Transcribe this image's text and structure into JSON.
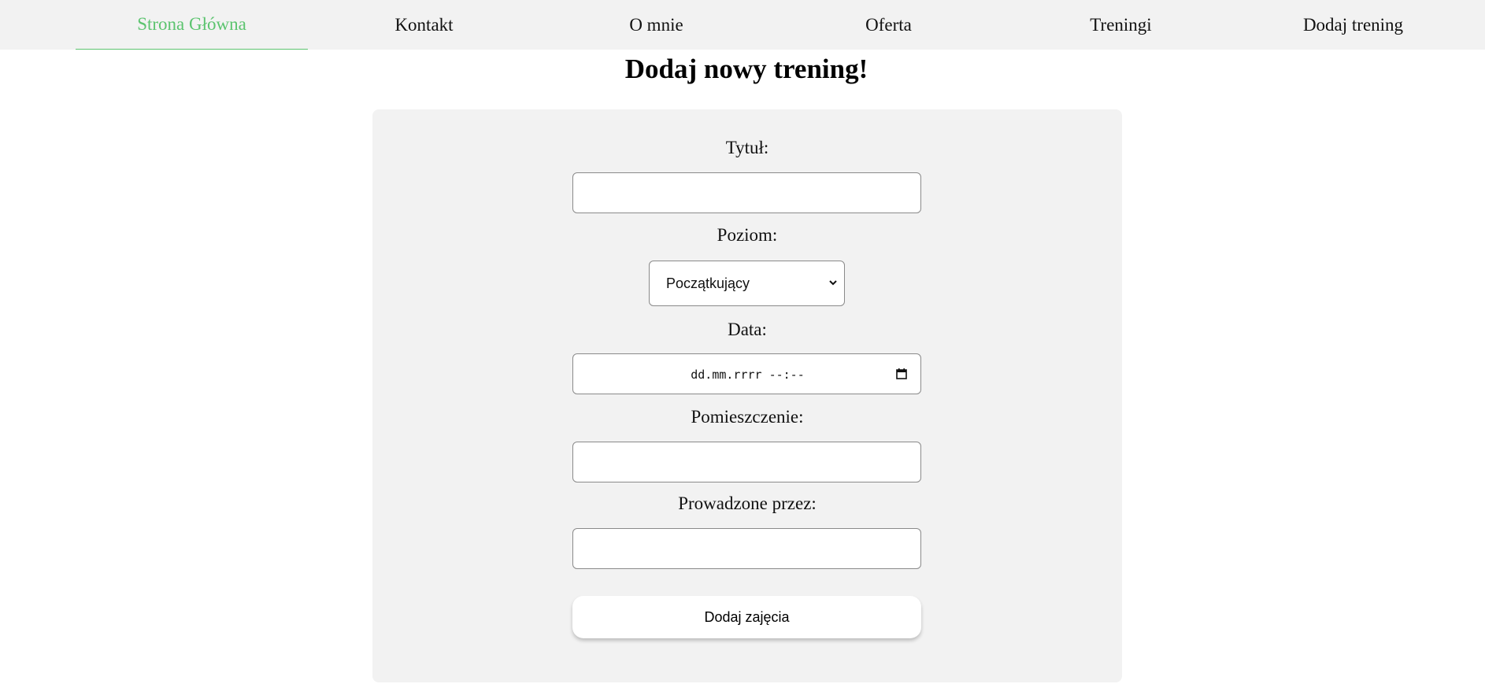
{
  "nav": {
    "items": [
      {
        "label": "Strona Główna"
      },
      {
        "label": "Kontakt"
      },
      {
        "label": "O mnie"
      },
      {
        "label": "Oferta"
      },
      {
        "label": "Treningi"
      },
      {
        "label": "Dodaj trening"
      }
    ],
    "active_index": 0
  },
  "page": {
    "title": "Dodaj nowy trening!"
  },
  "form": {
    "title_label": "Tytuł:",
    "title_value": "",
    "level_label": "Poziom:",
    "level_selected": "Początkujący",
    "date_label": "Data:",
    "date_placeholder": "dd.mm.rrrr --:--",
    "room_label": "Pomieszczenie:",
    "room_value": "",
    "trainer_label": "Prowadzone przez:",
    "trainer_value": "",
    "submit_label": "Dodaj zajęcia"
  },
  "colors": {
    "accent": "#5cc46f",
    "nav_background": "#f2f2f2",
    "card_background": "#f2f2f2"
  }
}
